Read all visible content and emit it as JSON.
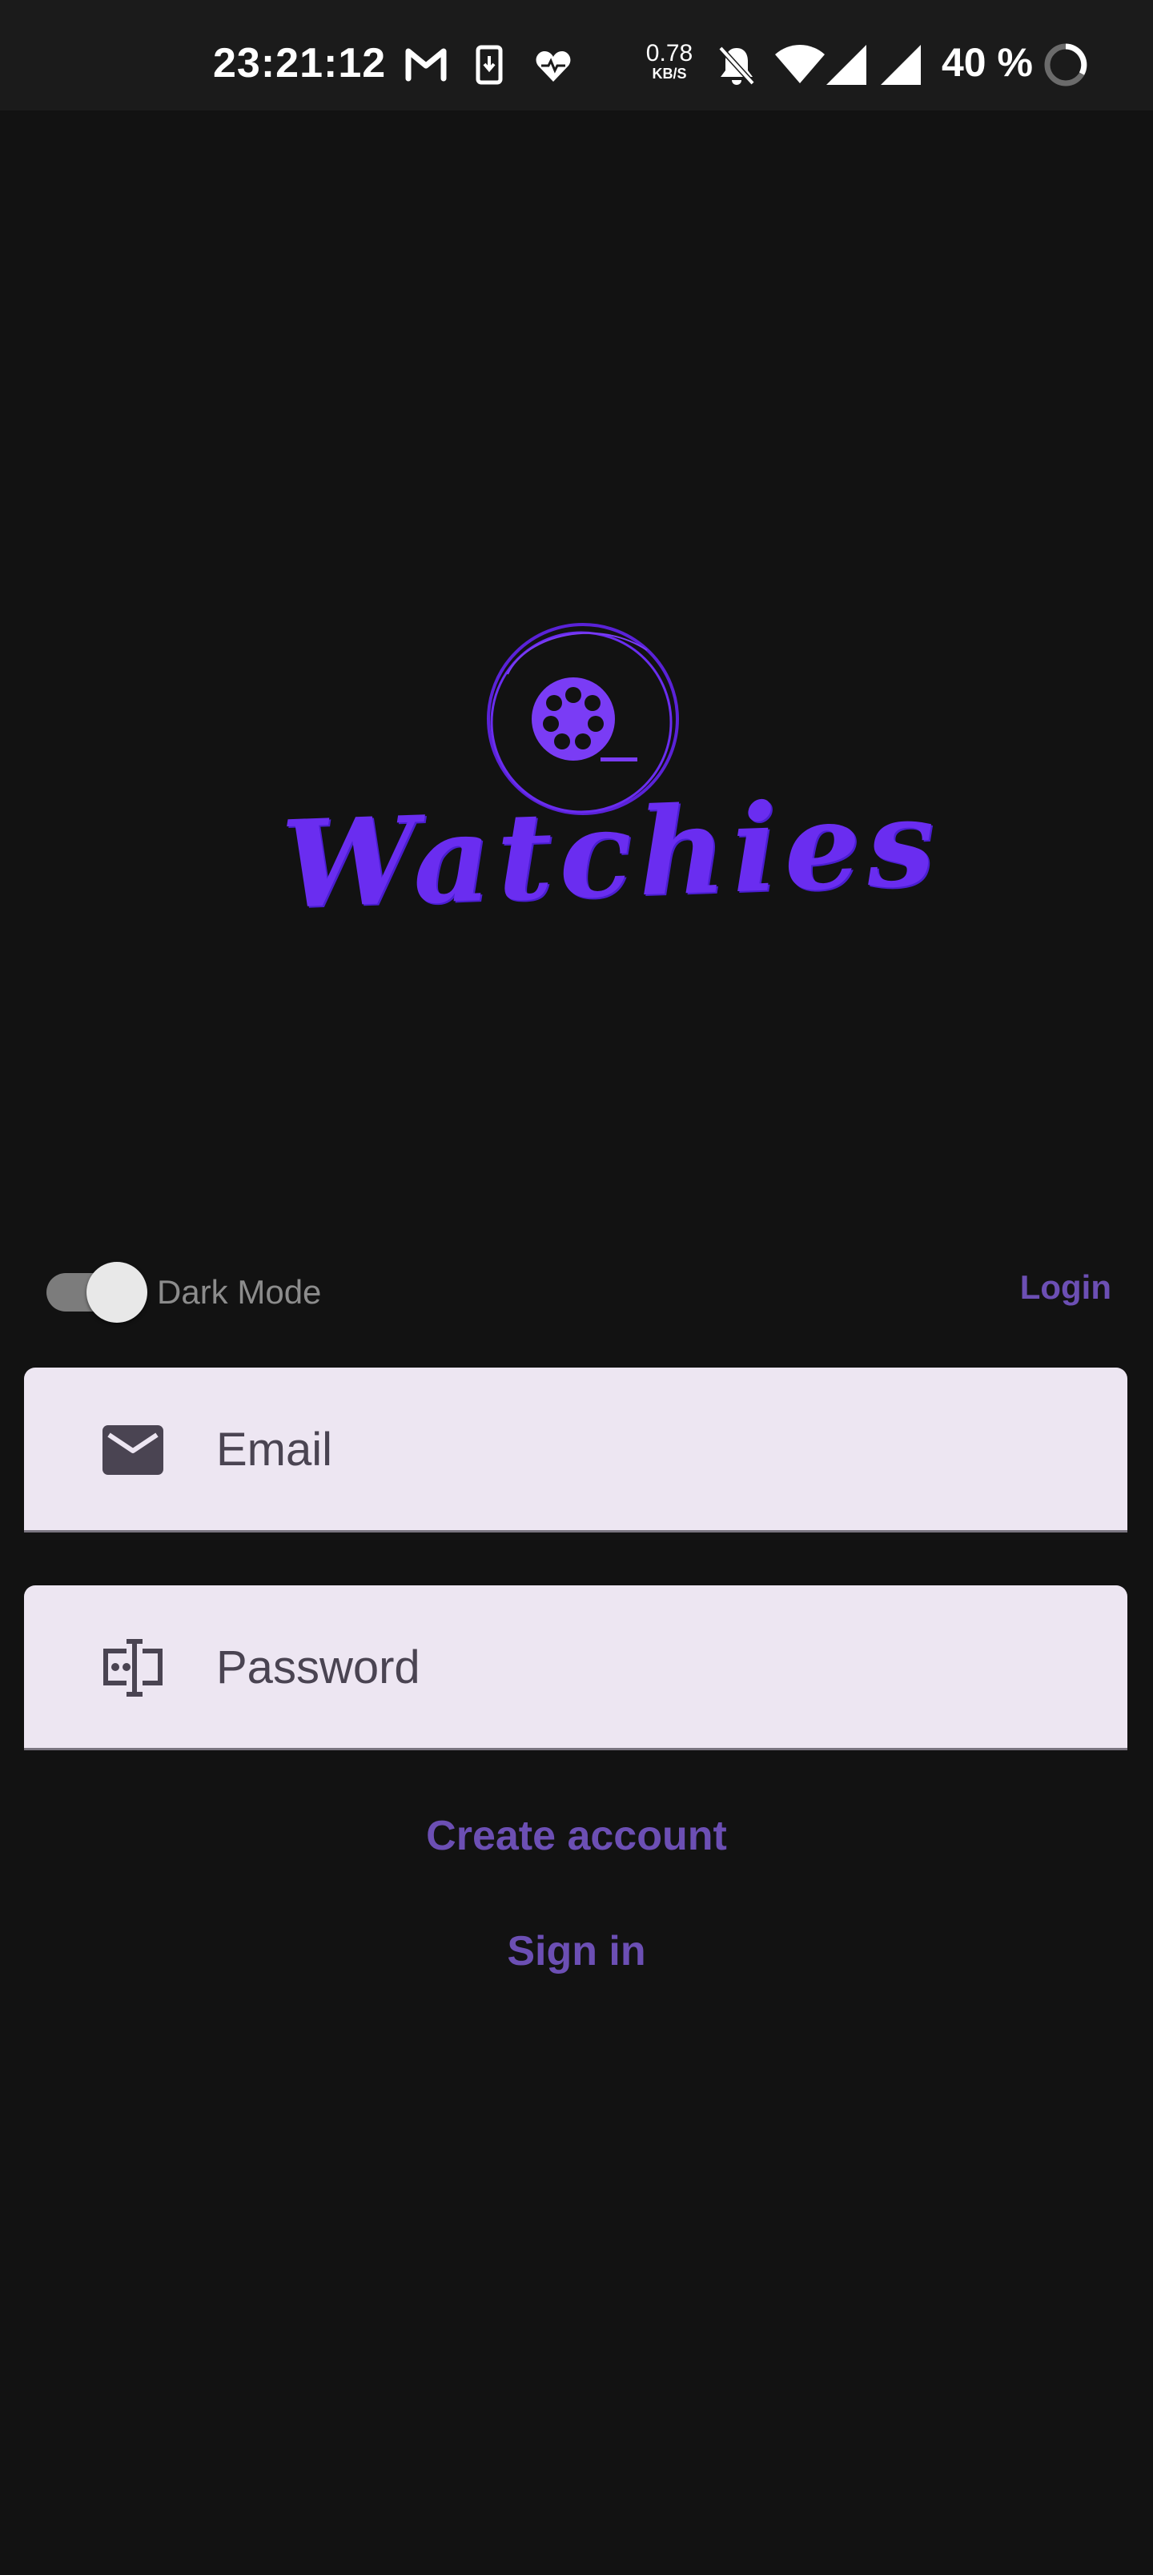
{
  "status_bar": {
    "time": "23:21:12",
    "net_speed_value": "0.78",
    "net_speed_unit": "KB/S",
    "battery_percent": "40 %",
    "icons": [
      "gmail-icon",
      "phone-download-icon",
      "heart-monitor-icon",
      "bell-off-icon",
      "wifi-icon",
      "signal-icon",
      "signal-icon",
      "battery-ring-icon"
    ]
  },
  "logo": {
    "wordmark": "Watchies",
    "icon": "film-reel-icon",
    "brand_color": "#6a2df0"
  },
  "settings": {
    "dark_mode_label": "Dark Mode",
    "dark_mode_on": true
  },
  "auth": {
    "mode_tab_label": "Login",
    "email": {
      "placeholder": "Email",
      "value": "",
      "icon": "mail-icon"
    },
    "password": {
      "placeholder": "Password",
      "value": "",
      "icon": "password-icon"
    },
    "create_account_label": "Create account",
    "sign_in_label": "Sign in"
  },
  "colors": {
    "background": "#121212",
    "accent": "#6c4fb4",
    "field_background": "#ede6f2",
    "field_text": "#4a4452"
  }
}
